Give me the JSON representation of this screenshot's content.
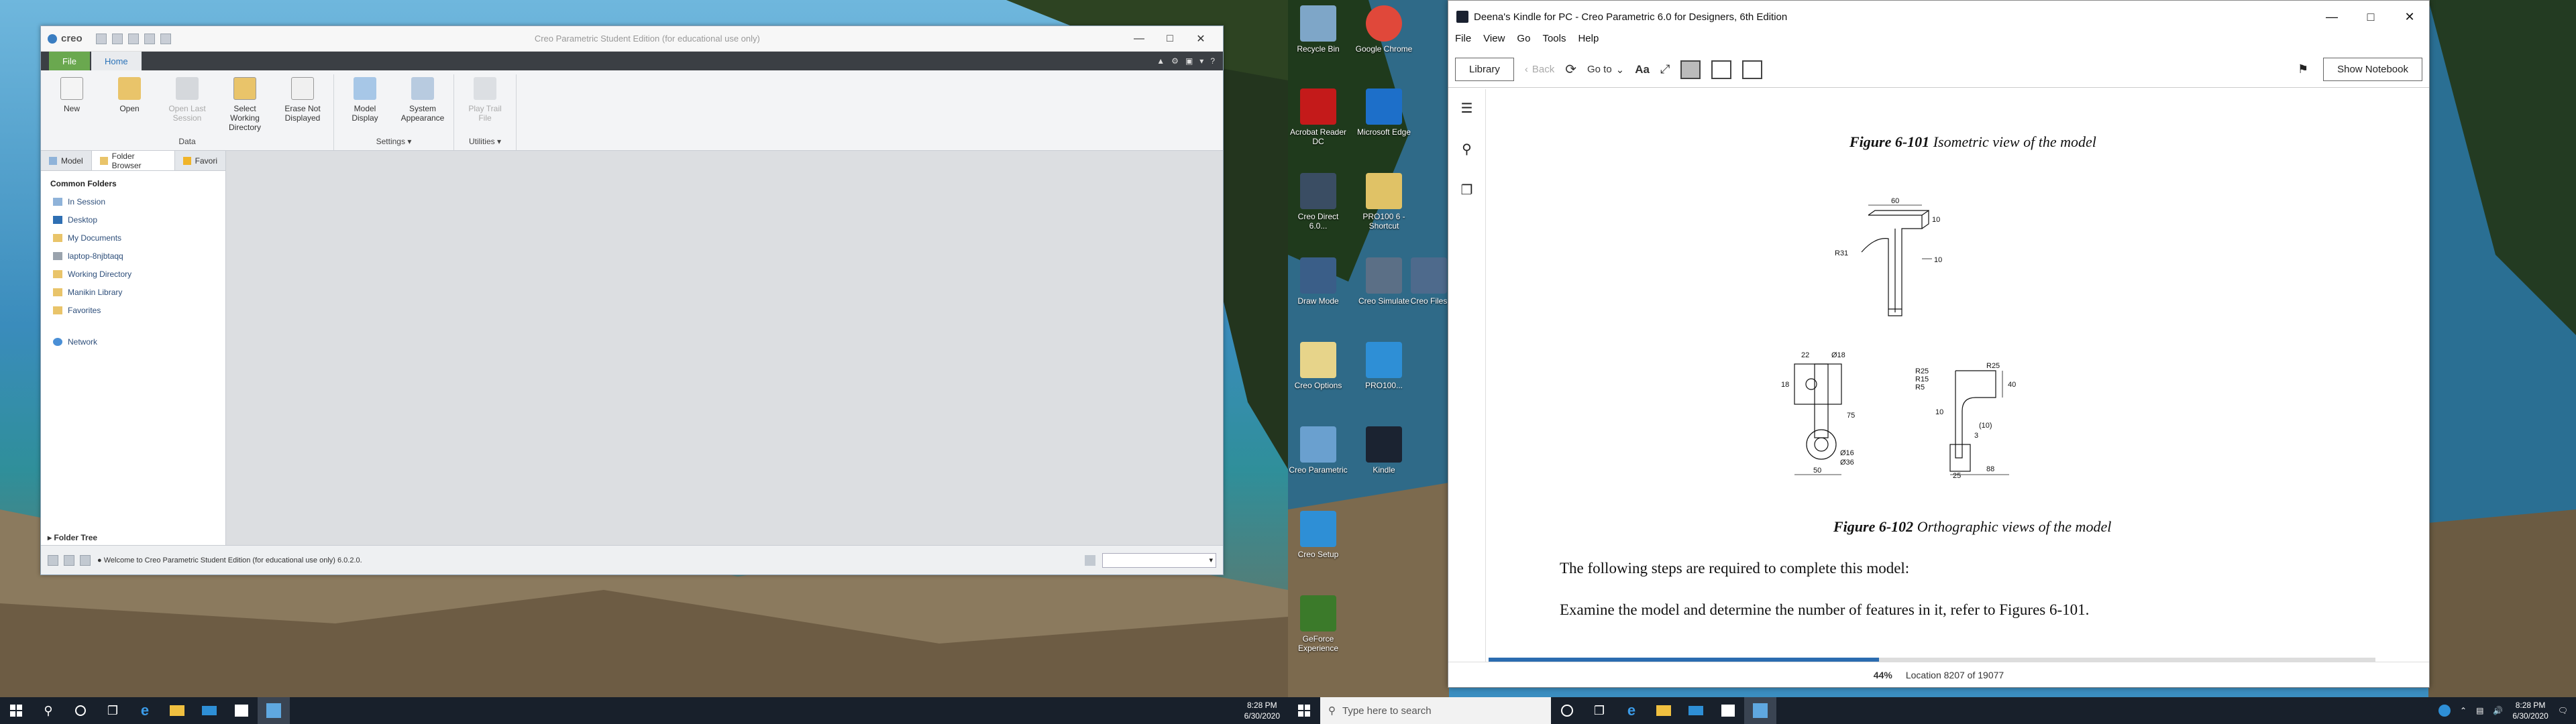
{
  "creo": {
    "title": "Creo Parametric Student Edition (for educational use only)",
    "logo": "creo",
    "tabs": [
      "File",
      "Home"
    ],
    "groups": [
      {
        "label": "Data",
        "buttons": [
          {
            "label": "New",
            "disabled": false,
            "icon": "new-file-icon"
          },
          {
            "label": "Open",
            "disabled": false,
            "icon": "open-folder-icon"
          },
          {
            "label": "Open Last Session",
            "disabled": true,
            "icon": "open-last-session-icon"
          },
          {
            "label": "Select Working Directory",
            "disabled": false,
            "icon": "working-directory-icon"
          },
          {
            "label": "Erase Not Displayed",
            "disabled": false,
            "icon": "erase-icon"
          }
        ]
      },
      {
        "label": "Settings",
        "buttons": [
          {
            "label": "Model Display",
            "disabled": false,
            "icon": "model-display-icon"
          },
          {
            "label": "System Appearance",
            "disabled": false,
            "icon": "system-appearance-icon"
          }
        ]
      },
      {
        "label": "Utilities",
        "buttons": [
          {
            "label": "Play Trail File",
            "disabled": true,
            "icon": "play-trail-icon"
          }
        ]
      }
    ],
    "panel_tabs": [
      "Model",
      "Folder Browser",
      "Favori"
    ],
    "common_folders_heading": "Common Folders",
    "folders": [
      "In Session",
      "Desktop",
      "My Documents",
      "laptop-8njbtaqq",
      "Working Directory",
      "Manikin Library",
      "Favorites"
    ],
    "network": "Network",
    "folder_tree": "Folder Tree",
    "status_message": "Welcome to Creo Parametric Student Edition (for educational use only) 6.0.2.0."
  },
  "kindle": {
    "title": "Deena's Kindle for PC - Creo Parametric 6.0 for Designers, 6th Edition",
    "menu": [
      "File",
      "View",
      "Go",
      "Tools",
      "Help"
    ],
    "library": "Library",
    "back": "Back",
    "goto": "Go to",
    "font_btn": "Aa",
    "show_notebook": "Show Notebook",
    "fig1_num": "Figure 6-101",
    "fig1_title": "Isometric view of the model",
    "fig2_num": "Figure 6-102",
    "fig2_title": "Orthographic views of the model",
    "para1": "The following steps are required to complete this model:",
    "para2": "Examine the model and determine the number of features in it, refer to Figures 6-101.",
    "percent": "44%",
    "location": "Location 8207 of 19077",
    "progress": 0.44,
    "dims_top": [
      "60",
      "10",
      "R31",
      "10"
    ],
    "dims_front": [
      "22",
      "Ø18",
      "18",
      "75",
      "Ø16",
      "Ø36",
      "50"
    ],
    "dims_side": [
      "R25",
      "R15",
      "R5",
      "R25",
      "10",
      "3",
      "(10)",
      "40",
      "88",
      "25"
    ]
  },
  "desktop_icons": [
    {
      "label": "Recycle Bin",
      "color": "#7ea6c8"
    },
    {
      "label": "Google Chrome",
      "color": "#e0483a"
    },
    {
      "label": "Acrobat Reader DC",
      "color": "#c41a1a"
    },
    {
      "label": "Microsoft Edge",
      "color": "#1d6fc9"
    },
    {
      "label": "Creo Direct 6.0...",
      "color": "#3a4d63"
    },
    {
      "label": "PRO100 6 - Shortcut",
      "color": "#e0c266"
    },
    {
      "label": "Draw Mode",
      "color": "#3a5e88"
    },
    {
      "label": "Creo Simulate",
      "color": "#5b6f86"
    },
    {
      "label": "Creo Files",
      "color": "#4e6a8c"
    },
    {
      "label": "Creo Options",
      "color": "#e7d48a"
    },
    {
      "label": "PRO100...",
      "color": "#2e8fd6"
    },
    {
      "label": "Creo Parametric",
      "color": "#6aa0cf"
    },
    {
      "label": "Kindle",
      "color": "#1b2331"
    },
    {
      "label": "Creo Setup",
      "color": "#2e8fd6"
    },
    {
      "label": "GeForce Experience",
      "color": "#3b7a2a"
    }
  ],
  "taskbar_left": {
    "time": "8:28 PM",
    "date": "6/30/2020"
  },
  "taskbar_right": {
    "search_placeholder": "Type here to search",
    "time": "8:28 PM",
    "date": "6/30/2020"
  }
}
